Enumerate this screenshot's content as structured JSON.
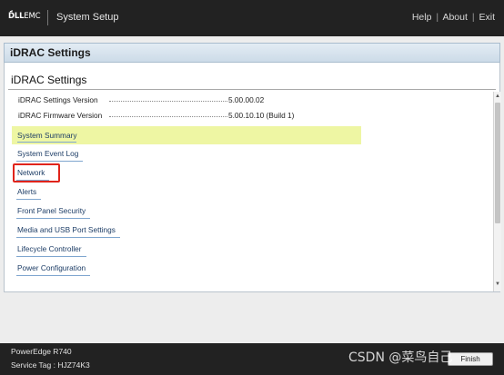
{
  "topbar": {
    "logo_bold": "D̈́LL",
    "logo_light": "EMC",
    "app_title": "System Setup",
    "links": {
      "help": "Help",
      "about": "About",
      "exit": "Exit",
      "separator": "|"
    }
  },
  "page": {
    "title": "iDRAC Settings"
  },
  "section": {
    "title": "iDRAC Settings",
    "info": [
      {
        "label": "iDRAC Settings Version",
        "value": "5.00.00.02"
      },
      {
        "label": "iDRAC Firmware Version",
        "value": "5.00.10.10 (Build 1)"
      }
    ],
    "items": [
      {
        "label": "System Summary",
        "selected": true
      },
      {
        "label": "System Event Log"
      },
      {
        "label": "Network",
        "annotated": true
      },
      {
        "label": "Alerts"
      },
      {
        "label": "Front Panel Security"
      },
      {
        "label": "Media and USB Port Settings"
      },
      {
        "label": "Lifecycle Controller"
      },
      {
        "label": "Power Configuration"
      }
    ]
  },
  "footer": {
    "model": "PowerEdge R740",
    "service_tag": "Service Tag : HJZ74K3",
    "watermark": "CSDN @菜鸟自己",
    "finish_label": "Finish"
  },
  "colors": {
    "topbar_bg": "#222222",
    "highlight": "#eef6a3",
    "link": "#1d3d66",
    "annotation": "#e0241b"
  },
  "icons": {
    "scroll_up": "triangle-up",
    "scroll_down": "triangle-down"
  }
}
